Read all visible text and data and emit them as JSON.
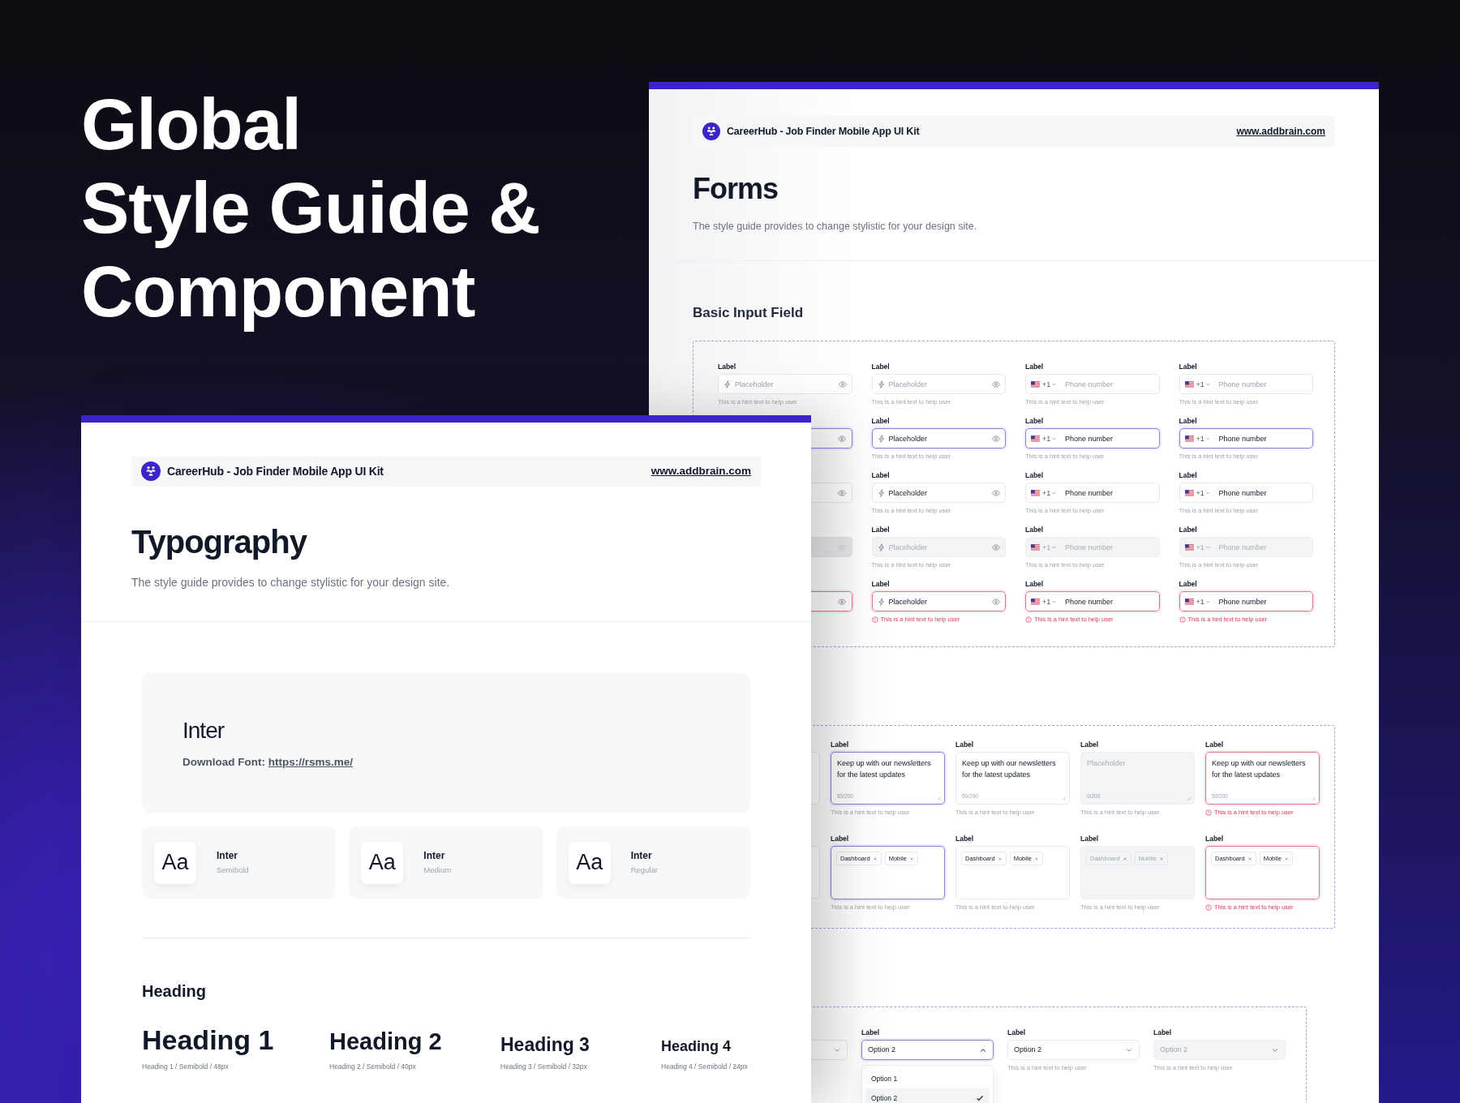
{
  "headline": [
    "Global",
    "Style Guide &",
    "Component"
  ],
  "forms_page": {
    "header": {
      "title": "CareerHub - Job Finder Mobile App UI Kit",
      "link": "www.addbrain.com"
    },
    "title": "Forms",
    "subtitle": "The style guide provides to change stylistic for your design site.",
    "basic_input": {
      "title": "Basic Input Field",
      "fields": [
        {
          "kind": "text",
          "focused": false,
          "disabled": false,
          "error": false,
          "label": "Label",
          "placeholder": "Placeholder",
          "hint": "This is a hint text to help user"
        },
        {
          "kind": "text",
          "focused": false,
          "disabled": false,
          "error": false,
          "label": "Label",
          "placeholder": "Placeholder",
          "hint": "This is a hint text to help user"
        },
        {
          "kind": "phone",
          "focused": false,
          "disabled": false,
          "error": false,
          "label": "Label",
          "code": "+1",
          "placeholder": "Phone number",
          "hint": "This is a hint text to help user"
        },
        {
          "kind": "phone",
          "focused": false,
          "disabled": false,
          "error": false,
          "label": "Label",
          "code": "+1",
          "placeholder": "Phone number",
          "hint": "This is a hint text to help user"
        },
        {
          "kind": "text",
          "focused": true,
          "disabled": false,
          "error": false
        },
        {
          "kind": "text",
          "focused": true,
          "disabled": false,
          "error": false,
          "label": "Label",
          "value": "Placeholder",
          "hint": "This is a hint text to help user"
        },
        {
          "kind": "phone",
          "focused": true,
          "disabled": false,
          "error": false,
          "label": "Label",
          "code": "+1",
          "value": "Phone number",
          "hint": "This is a hint text to help user"
        },
        {
          "kind": "phone",
          "focused": true,
          "disabled": false,
          "error": false,
          "label": "Label",
          "code": "+1",
          "value": "Phone number",
          "hint": "This is a hint text to help user"
        },
        {
          "kind": "text",
          "focused": false,
          "disabled": false,
          "error": false
        },
        {
          "kind": "text",
          "focused": false,
          "disabled": false,
          "error": false,
          "label": "Label",
          "value": "Placeholder",
          "hint": "This is a hint text to help user"
        },
        {
          "kind": "phone",
          "focused": false,
          "disabled": false,
          "error": false,
          "label": "Label",
          "code": "+1",
          "value": "Phone number",
          "hint": "This is a hint text to help user"
        },
        {
          "kind": "phone",
          "focused": false,
          "disabled": false,
          "error": false,
          "label": "Label",
          "code": "+1",
          "value": "Phone number",
          "hint": "This is a hint text to help user"
        },
        {
          "kind": "text",
          "focused": false,
          "disabled": true,
          "error": false
        },
        {
          "kind": "text",
          "focused": false,
          "disabled": true,
          "error": false,
          "label": "Label",
          "placeholder": "Placeholder",
          "hint": "This is a hint text to help user"
        },
        {
          "kind": "phone",
          "focused": false,
          "disabled": true,
          "error": false,
          "label": "Label",
          "code": "+1",
          "placeholder": "Phone number",
          "hint": "This is a hint text to help user"
        },
        {
          "kind": "phone",
          "focused": false,
          "disabled": true,
          "error": false,
          "label": "Label",
          "code": "+1",
          "placeholder": "Phone number",
          "hint": "This is a hint text to help user"
        },
        {
          "kind": "text",
          "focused": false,
          "disabled": false,
          "error": true
        },
        {
          "kind": "text",
          "focused": false,
          "disabled": false,
          "error": true,
          "label": "Label",
          "value": "Placeholder",
          "hint": "This is a hint text to help user"
        },
        {
          "kind": "phone",
          "focused": false,
          "disabled": false,
          "error": true,
          "label": "Label",
          "code": "+1",
          "value": "Phone number",
          "hint": "This is a hint text to help user"
        },
        {
          "kind": "phone",
          "focused": false,
          "disabled": false,
          "error": true,
          "label": "Label",
          "code": "+1",
          "value": "Phone number",
          "hint": "This is a hint text to help user"
        }
      ]
    },
    "text_area": {
      "fields": [
        {
          "kind": "textarea",
          "focused": false,
          "disabled": false,
          "error": false
        },
        {
          "kind": "textarea",
          "focused": true,
          "disabled": false,
          "error": false,
          "label": "Label",
          "value": "Keep up with our newsletters for the latest updates",
          "counter": "50/200",
          "hint": "This is a hint text to help user"
        },
        {
          "kind": "textarea",
          "focused": false,
          "disabled": false,
          "error": false,
          "label": "Label",
          "value": "Keep up with our newsletters for the latest updates",
          "counter": "50/200",
          "hint": "This is a hint text to help user"
        },
        {
          "kind": "textarea",
          "focused": false,
          "disabled": true,
          "error": false,
          "label": "Label",
          "placeholder": "Placeholder",
          "counter": "0/200",
          "hint": "This is a hint text to help user"
        },
        {
          "kind": "textarea",
          "focused": false,
          "disabled": false,
          "error": true,
          "label": "Label",
          "value": "Keep up with our newsletters for the latest updates",
          "counter": "50/200",
          "hint": "This is a hint text to help user"
        },
        {
          "kind": "tags",
          "focused": false,
          "disabled": false,
          "error": false
        },
        {
          "kind": "tags",
          "focused": true,
          "disabled": false,
          "error": false,
          "label": "Label",
          "tags": [
            "Dashboard",
            "Mobile"
          ],
          "hint": "This is a hint text to help user"
        },
        {
          "kind": "tags",
          "focused": false,
          "disabled": false,
          "error": false,
          "label": "Label",
          "tags": [
            "Dashboard",
            "Mobile"
          ],
          "hint": "This is a hint text to help user"
        },
        {
          "kind": "tags",
          "focused": false,
          "disabled": true,
          "error": false,
          "label": "Label",
          "tags": [
            "Dashboard",
            "Mobile"
          ],
          "hint": "This is a hint text to help user"
        },
        {
          "kind": "tags",
          "focused": false,
          "disabled": false,
          "error": true,
          "label": "Label",
          "tags": [
            "Dashboard",
            "Mobile"
          ],
          "hint": "This is a hint text to help user"
        }
      ]
    },
    "select": {
      "fields": [
        {
          "kind": "select",
          "focused": false,
          "disabled": false,
          "error": false,
          "expanded": false
        },
        {
          "kind": "select",
          "focused": true,
          "disabled": false,
          "error": false,
          "label": "Label",
          "value": "Option 2",
          "expanded": true,
          "options": [
            {
              "label": "Option 1",
              "selected": false
            },
            {
              "label": "Option 2",
              "selected": true
            }
          ]
        },
        {
          "kind": "select",
          "focused": false,
          "disabled": false,
          "error": false,
          "label": "Label",
          "value": "Option 2",
          "expanded": false,
          "hint": "This is a hint text to help user"
        },
        {
          "kind": "select",
          "focused": false,
          "disabled": true,
          "error": false,
          "label": "Label",
          "value": "Option 2",
          "expanded": false,
          "hint": "This is a hint text to help user"
        }
      ]
    }
  },
  "typography_page": {
    "header": {
      "title": "CareerHub - Job Finder Mobile App UI Kit",
      "link": "www.addbrain.com"
    },
    "title": "Typography",
    "subtitle": "The style guide provides to change stylistic for your design site.",
    "font": {
      "name": "Inter",
      "download_label": "Download Font:",
      "link": "https://rsms.me/"
    },
    "weights": [
      {
        "sample": "Aa",
        "name": "Inter",
        "weight": "Semibold"
      },
      {
        "sample": "Aa",
        "name": "Inter",
        "weight": "Medium"
      },
      {
        "sample": "Aa",
        "name": "Inter",
        "weight": "Regular"
      }
    ],
    "heading_section": {
      "title": "Heading",
      "items": [
        {
          "text": "Heading 1",
          "caption": "Heading 1 / Semibold / 48px"
        },
        {
          "text": "Heading 2",
          "caption": "Heading 2 / Semibold / 40px"
        },
        {
          "text": "Heading 3",
          "caption": "Heading 3 / Semibold / 32px"
        },
        {
          "text": "Heading 4",
          "caption": "Heading 4 / Semibold / 24px"
        }
      ]
    }
  }
}
